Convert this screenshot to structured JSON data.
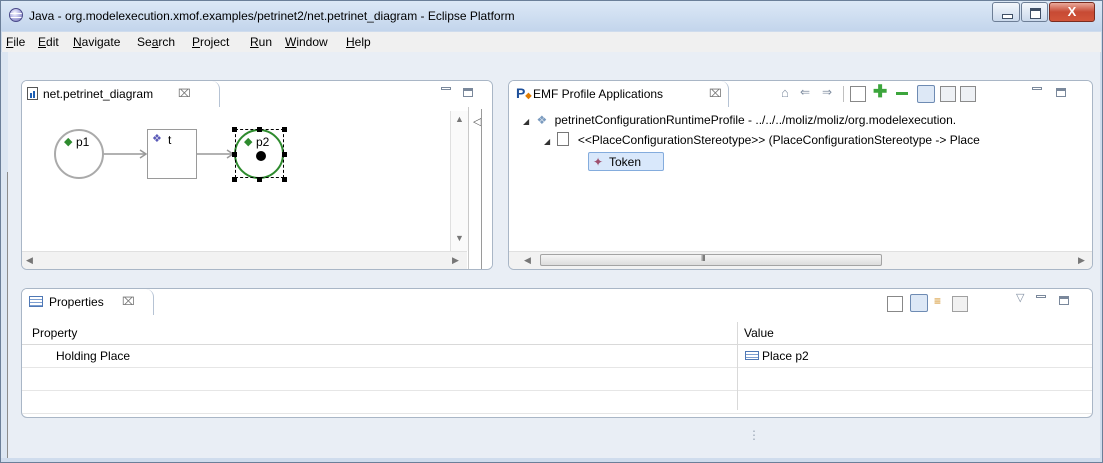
{
  "window": {
    "title": "Java - org.modelexecution.xmof.examples/petrinet2/net.petrinet_diagram - Eclipse Platform",
    "close_glyph": "X"
  },
  "menu": [
    {
      "label": "File",
      "mnemonic": "F",
      "rest": "ile"
    },
    {
      "label": "Edit",
      "mnemonic": "E",
      "rest": "dit"
    },
    {
      "label": "Navigate",
      "mnemonic": "N",
      "rest": "avigate"
    },
    {
      "label": "Search",
      "pre": "Se",
      "mnemonic": "a",
      "rest": "rch"
    },
    {
      "label": "Project",
      "mnemonic": "P",
      "rest": "roject"
    },
    {
      "label": "Run",
      "mnemonic": "R",
      "rest": "un"
    },
    {
      "label": "Window",
      "mnemonic": "W",
      "rest": "indow"
    },
    {
      "label": "Help",
      "mnemonic": "H",
      "rest": "elp"
    }
  ],
  "editor": {
    "tab_label": "net.petrinet_diagram",
    "close_glyph": "⌧",
    "collapse_glyph": "◁",
    "diagram": {
      "places": [
        {
          "label": "p1",
          "tokens": 0,
          "selected": false
        },
        {
          "label": "p2",
          "tokens": 1,
          "selected": true
        }
      ],
      "transitions": [
        {
          "label": "t"
        }
      ]
    }
  },
  "emf_view": {
    "tab_label": "EMF Profile Applications",
    "close_glyph": "⌧",
    "tree": [
      {
        "label": "petrinetConfigurationRuntimeProfile - ../../../moliz/moliz/org.modelexecution."
      },
      {
        "label": "<<PlaceConfigurationStereotype>> (PlaceConfigurationStereotype -> Place"
      },
      {
        "label": "Token",
        "selected": true
      }
    ],
    "scroll_grip": "III"
  },
  "properties": {
    "tab_label": "Properties",
    "close_glyph": "⌧",
    "columns": [
      "Property",
      "Value"
    ],
    "rows": [
      {
        "property": "Holding Place",
        "value": "Place p2"
      }
    ],
    "view_menu_glyph": "▽",
    "resize_grip": "⋮"
  },
  "colors": {
    "accent_green": "#2e8b2e",
    "selection": "#d9e8fb",
    "tree_icon": "#7b4fbf"
  }
}
